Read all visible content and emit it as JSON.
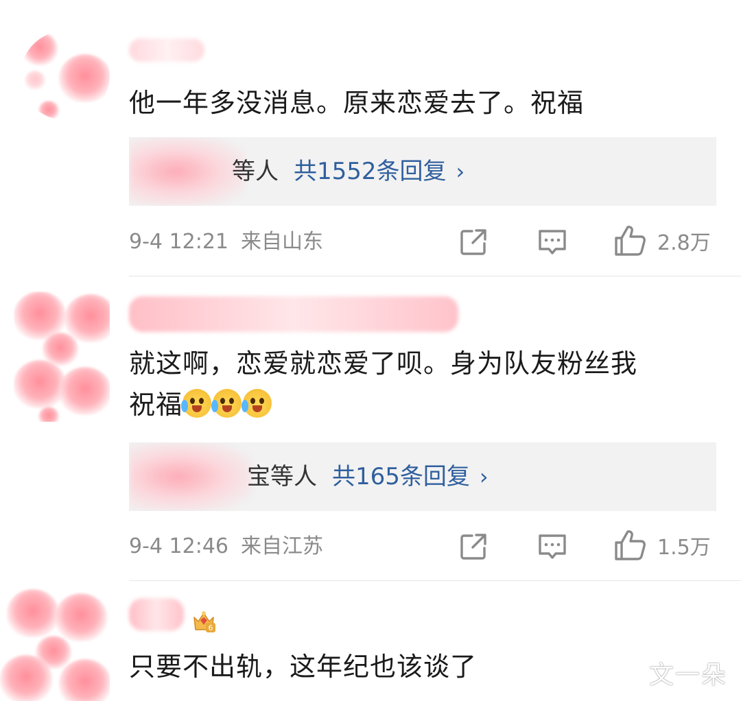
{
  "comments": [
    {
      "text": "他一年多没消息。原来恋爱去了。祝福",
      "reply_prefix": "等人",
      "reply_count_label": "共1552条回复",
      "time": "9-4 12:21",
      "location": "来自山东",
      "likes": "2.8万"
    },
    {
      "text_line1": "就这啊，恋爱就恋爱了呗。身为队友粉丝我",
      "text_line2": "祝福",
      "reply_prefix": "宝等人",
      "reply_count_label": "共165条回复",
      "time": "9-4 12:46",
      "location": "来自江苏",
      "likes": "1.5万"
    },
    {
      "text": "只要不出轨，这年纪也该谈了",
      "badge_level": "6"
    }
  ],
  "icons": {
    "share": "share-icon",
    "comment": "comment-icon",
    "like": "thumbs-up-icon",
    "chevron": "chevron-right-icon"
  },
  "watermark": "文一朵",
  "colors": {
    "link": "#2f5f9e",
    "meta": "#8a8a8a",
    "reply_bg": "#f2f2f2"
  }
}
